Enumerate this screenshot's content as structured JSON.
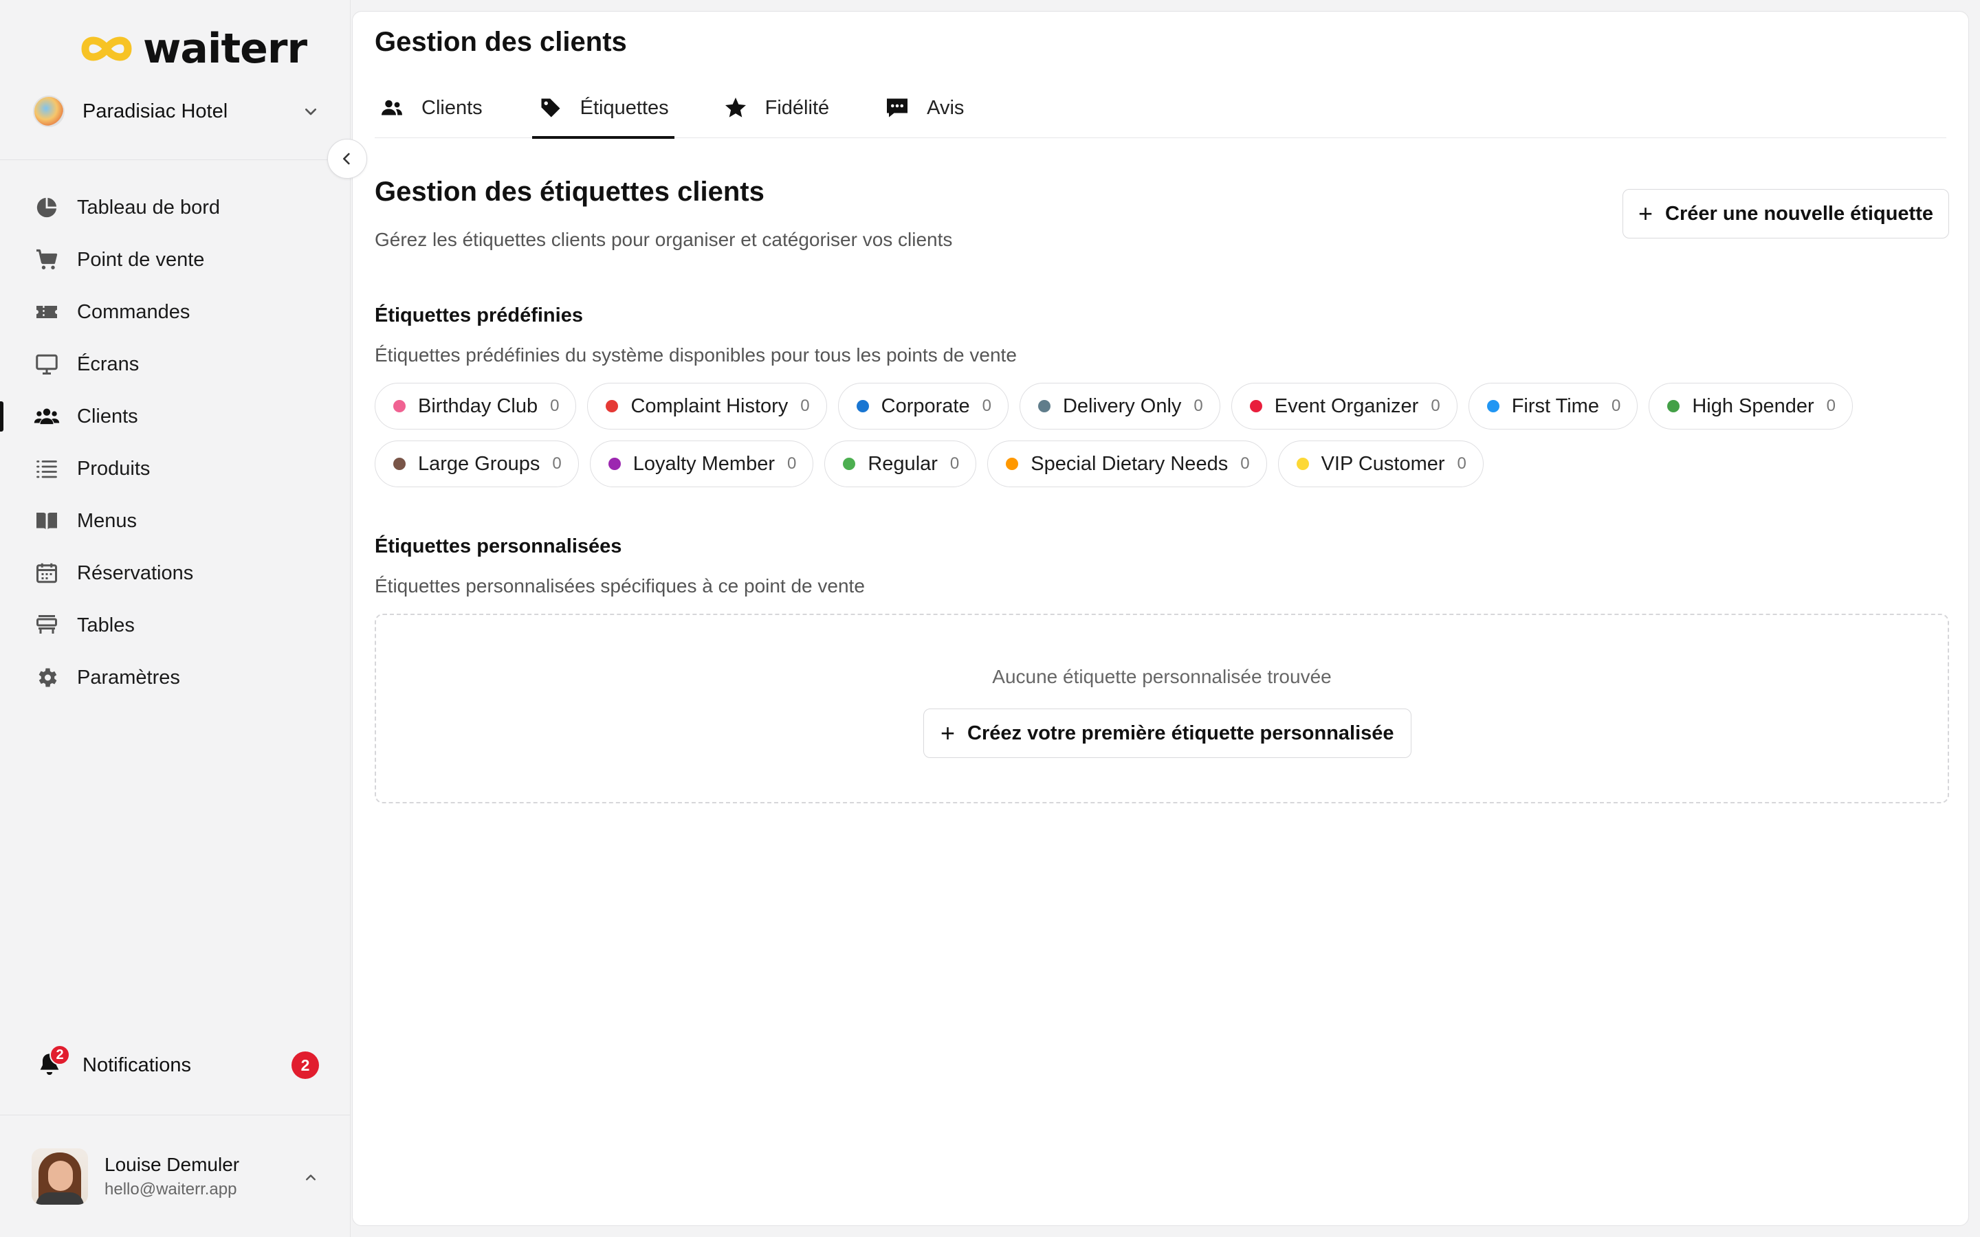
{
  "brand": {
    "name": "waiterr",
    "accent": "#f7c325"
  },
  "venue": {
    "name": "Paradisiac Hotel"
  },
  "sidebar": {
    "items": [
      {
        "label": "Tableau de bord",
        "icon": "pie-chart-icon"
      },
      {
        "label": "Point de vente",
        "icon": "cart-icon"
      },
      {
        "label": "Commandes",
        "icon": "ticket-icon"
      },
      {
        "label": "Écrans",
        "icon": "monitor-icon"
      },
      {
        "label": "Clients",
        "icon": "users-icon",
        "active": true
      },
      {
        "label": "Produits",
        "icon": "list-icon"
      },
      {
        "label": "Menus",
        "icon": "book-icon"
      },
      {
        "label": "Réservations",
        "icon": "calendar-icon"
      },
      {
        "label": "Tables",
        "icon": "table-icon"
      },
      {
        "label": "Paramètres",
        "icon": "gear-icon"
      }
    ],
    "notifications": {
      "label": "Notifications",
      "count": "2"
    },
    "user": {
      "name": "Louise Demuler",
      "email": "hello@waiterr.app"
    }
  },
  "page": {
    "title": "Gestion des clients",
    "tabs": [
      {
        "label": "Clients",
        "icon": "users-icon"
      },
      {
        "label": "Étiquettes",
        "icon": "tag-icon",
        "active": true
      },
      {
        "label": "Fidélité",
        "icon": "star-icon"
      },
      {
        "label": "Avis",
        "icon": "comment-icon"
      }
    ]
  },
  "tags_section": {
    "title": "Gestion des étiquettes clients",
    "description": "Gérez les étiquettes clients pour organiser et catégoriser vos clients",
    "create_button": "Créer une nouvelle étiquette",
    "predefined": {
      "title": "Étiquettes prédéfinies",
      "description": "Étiquettes prédéfinies du système disponibles pour tous les points de vente",
      "tags": [
        {
          "name": "Birthday Club",
          "count": "0",
          "color": "#f06292"
        },
        {
          "name": "Complaint History",
          "count": "0",
          "color": "#e53935"
        },
        {
          "name": "Corporate",
          "count": "0",
          "color": "#1976d2"
        },
        {
          "name": "Delivery Only",
          "count": "0",
          "color": "#607d8b"
        },
        {
          "name": "Event Organizer",
          "count": "0",
          "color": "#e91e3c"
        },
        {
          "name": "First Time",
          "count": "0",
          "color": "#2196f3"
        },
        {
          "name": "High Spender",
          "count": "0",
          "color": "#43a047"
        },
        {
          "name": "Large Groups",
          "count": "0",
          "color": "#795548"
        },
        {
          "name": "Loyalty Member",
          "count": "0",
          "color": "#9c27b0"
        },
        {
          "name": "Regular",
          "count": "0",
          "color": "#4caf50"
        },
        {
          "name": "Special Dietary Needs",
          "count": "0",
          "color": "#ff9800"
        },
        {
          "name": "VIP Customer",
          "count": "0",
          "color": "#fdd835"
        }
      ]
    },
    "custom": {
      "title": "Étiquettes personnalisées",
      "description": "Étiquettes personnalisées spécifiques à ce point de vente",
      "empty_text": "Aucune étiquette personnalisée trouvée",
      "empty_button": "Créez votre première étiquette personnalisée"
    }
  }
}
